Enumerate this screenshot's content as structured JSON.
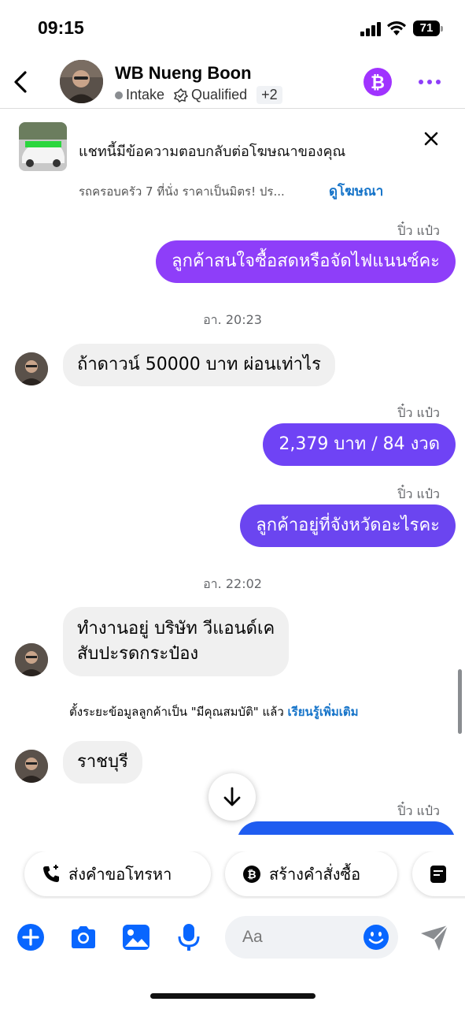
{
  "status_bar": {
    "time": "09:15",
    "battery": "71"
  },
  "header": {
    "name": "WB Nueng Boon",
    "tags": [
      {
        "label": "Intake",
        "icon": "gray-dot-icon"
      },
      {
        "label": "Qualified",
        "icon": "qualified-icon"
      }
    ],
    "more_tags": "+2"
  },
  "ad_banner": {
    "title": "แชทนี้มีข้อความตอบกลับต่อโฆษณาของคุณ",
    "subtitle": "รถครอบครัว 7 ที่นั่ง ราคาเป็นมิตร! ปร...",
    "link": "ดูโฆษณา"
  },
  "messages": {
    "m1_sender": "ปิ๋ว แป๋ว",
    "m1_text": "ลูกค้าสนใจซื้อสดหรือจัดไฟแนนซ์คะ",
    "time1": "อา. 20:23",
    "m2_text": "ถ้าดาวน์ 50000 บาท ผ่อนเท่าไร",
    "m3_sender": "ปิ๋ว แป๋ว",
    "m3_text": "2,379 บาท   / 84 งวด",
    "m4_sender": "ปิ๋ว แป๋ว",
    "m4_text": "ลูกค้าอยู่ที่จังหวัดอะไรคะ",
    "time2": "อา. 22:02",
    "m5_line1": "ทำงานอยู่ บริษัท วีแอนด์เค",
    "m5_line2": "สับปะรดกระป๋อง",
    "sys_text": "ตั้งระยะข้อมูลลูกค้าเป็น \"มีคุณสมบัติ\" แล้ว",
    "sys_link": "เรียนรู้เพิ่มเติม",
    "m6_text": "ราชบุรี",
    "m7_sender": "ปิ๋ว แป๋ว"
  },
  "quick_actions": {
    "call_request": "ส่งคำขอโทรหา",
    "create_order": "สร้างคำสั่งซื้อ"
  },
  "composer": {
    "placeholder": "Aa"
  },
  "colors": {
    "bubble_purple": "#8e3ef9",
    "bubble_violet": "#6f43f5",
    "bubble_blue": "#1f5cf0",
    "accent_blue": "#0866ff",
    "link_blue": "#1674c9",
    "bitcoin_purple": "#a033ff"
  }
}
